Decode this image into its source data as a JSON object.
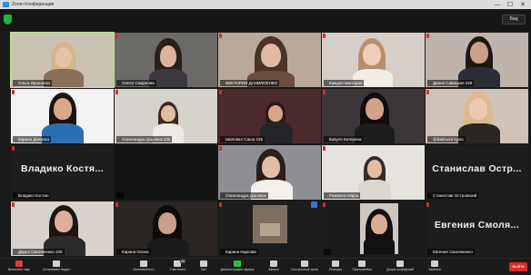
{
  "window": {
    "title": "Zoom Конференция"
  },
  "controls": {
    "minimize": "—",
    "maximize": "☐",
    "close": "✕"
  },
  "view_button": "Вид",
  "participants": [
    {
      "name": "Ольга Ярошенко",
      "active": true
    },
    {
      "name": "Олеся Смирнова"
    },
    {
      "name": "ВИКТОРИЯ ДАНИЛОЕНКО"
    },
    {
      "name": "Каждая Виктория"
    },
    {
      "name": "Диана Савицкая 225"
    },
    {
      "name": "Карина Данилко"
    },
    {
      "name": "Олександра Дзьонюк 225"
    },
    {
      "name": "Шаповал Саша 225"
    },
    {
      "name": "Бакуля Катерина"
    },
    {
      "name": "@Bakhova Irgna"
    },
    {
      "name": "Владико Костин",
      "display_name": "Владико Костя..."
    },
    {
      "name": ""
    },
    {
      "name": "Олександра Дзьонюк"
    },
    {
      "name": "Романюк Мірра"
    },
    {
      "name": "Станислав Островский",
      "display_name": "Станислав Остр..."
    },
    {
      "name": "Дарья Смоляненко 225"
    },
    {
      "name": "Карина Осина"
    },
    {
      "name": "Карина Карпова"
    },
    {
      "name": ""
    },
    {
      "name": "Евгения Смоляненко",
      "display_name": "Евгения Смоля..."
    }
  ],
  "toolbar": {
    "items": [
      {
        "label": "Включить звук",
        "icon": "mic-icon"
      },
      {
        "label": "Остановить видео",
        "icon": "video-icon"
      },
      {
        "label": "Безопасность",
        "icon": "shield-icon"
      },
      {
        "label": "Участники",
        "icon": "participants-icon",
        "count": "20"
      },
      {
        "label": "Чат",
        "icon": "chat-icon"
      },
      {
        "label": "Демонстрация экрана",
        "icon": "share-screen-icon"
      },
      {
        "label": "Запись",
        "icon": "record-icon"
      },
      {
        "label": "Сессионные залы",
        "icon": "rooms-icon"
      },
      {
        "label": "Реакции",
        "icon": "reactions-icon"
      },
      {
        "label": "Приложения",
        "icon": "apps-icon"
      },
      {
        "label": "Доска сообщений",
        "icon": "whiteboard-icon"
      },
      {
        "label": "Заметки",
        "icon": "notes-icon"
      }
    ],
    "end_label": "Выйти"
  }
}
